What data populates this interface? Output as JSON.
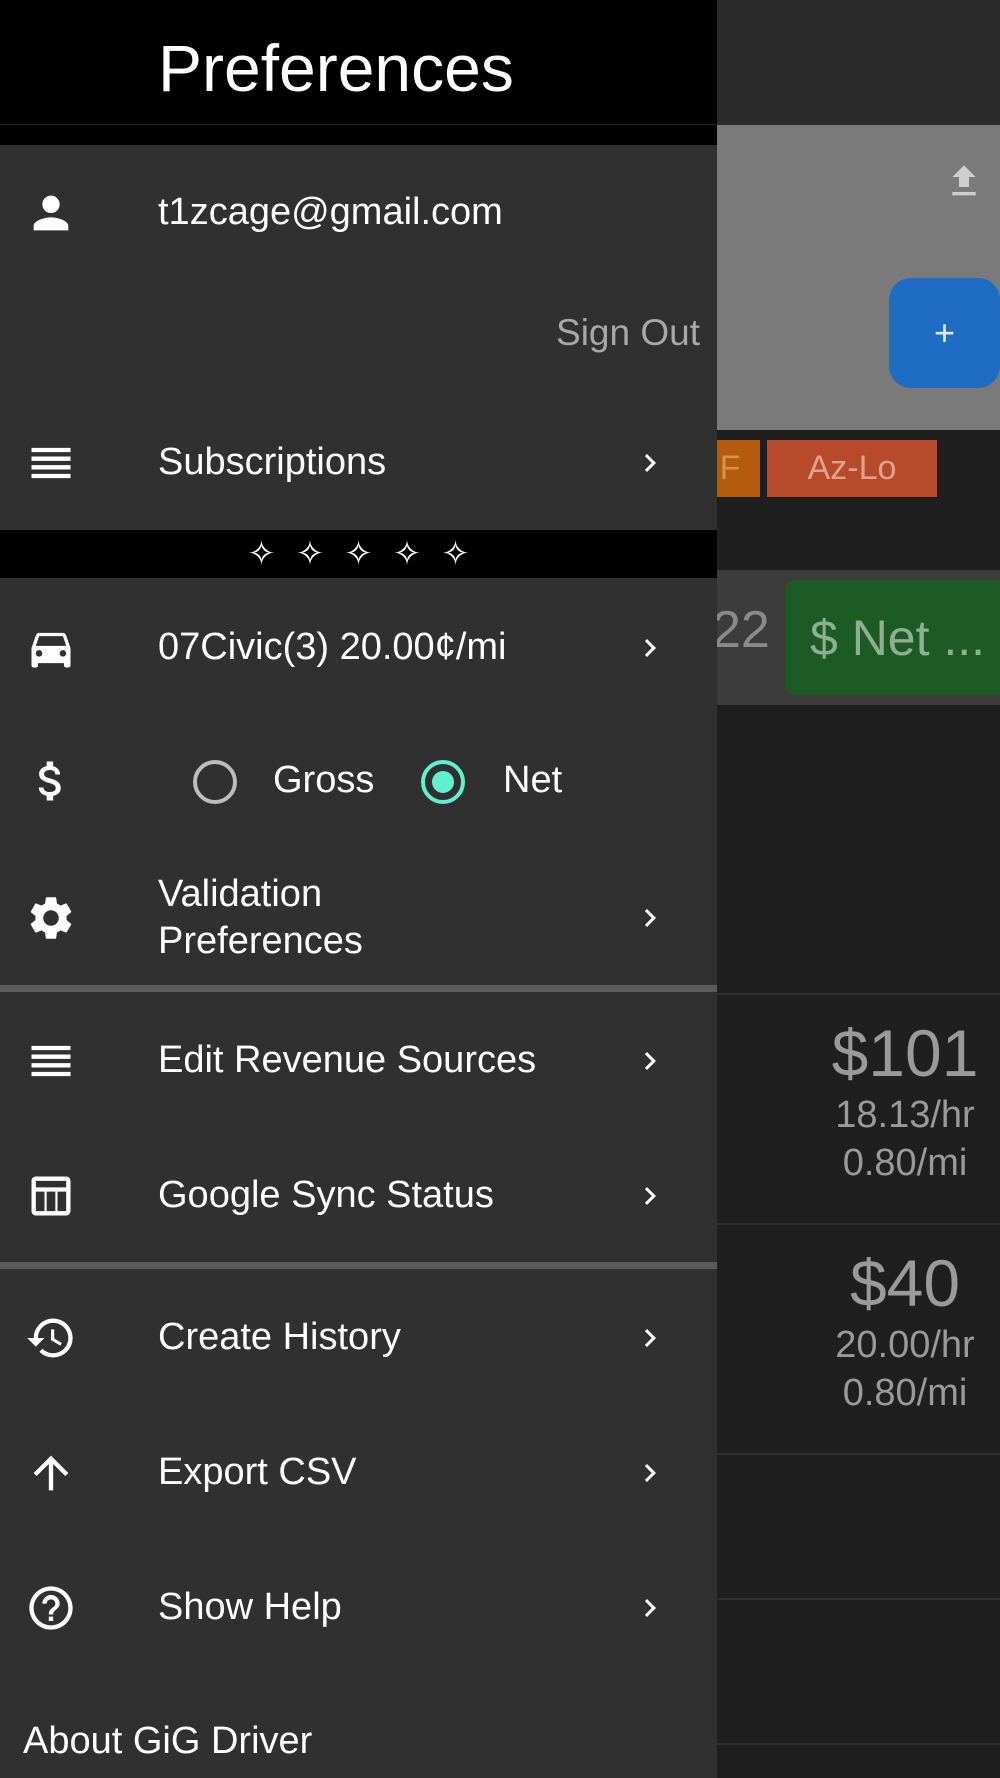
{
  "background": {
    "chips": {
      "sf": "F",
      "azlo": "Az-Lo",
      "net": "$ Net ..."
    },
    "band_number": "22",
    "fab_label": "+",
    "rows": [
      {
        "amount": "$101",
        "rate_hr": "18.13/hr",
        "rate_mi": "0.80/mi"
      },
      {
        "amount": "$40",
        "rate_hr": "20.00/hr",
        "rate_mi": "0.80/mi"
      }
    ]
  },
  "drawer": {
    "title": "Preferences",
    "account_email": "t1zcage@gmail.com",
    "sign_out": "Sign Out",
    "subscriptions": "Subscriptions",
    "rating_stars": [
      "✧",
      "✧",
      "✧",
      "✧",
      "✧"
    ],
    "vehicle": "07Civic(3) 20.00¢/mi",
    "revenue_mode": {
      "options": [
        "Gross",
        "Net"
      ],
      "selected": "Net"
    },
    "validation_preferences_line1": "Validation",
    "validation_preferences_line2": "Preferences",
    "edit_revenue_sources": "Edit Revenue Sources",
    "google_sync_status": "Google Sync Status",
    "create_history": "Create History",
    "export_csv": "Export CSV",
    "show_help": "Show Help",
    "about": "About GiG Driver"
  },
  "colors": {
    "drawer_bg": "#303030",
    "header_bg": "#000000",
    "radio_accent": "#5ff0d0",
    "fab": "#1f6cc4"
  }
}
